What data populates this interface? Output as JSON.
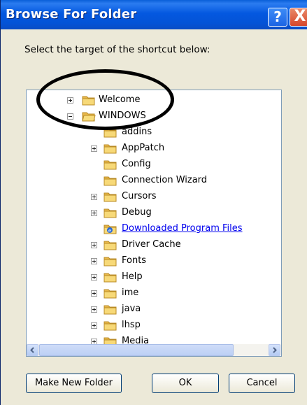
{
  "dialog": {
    "title": "Browse For Folder",
    "help_button": "?",
    "close_button": "X",
    "prompt": "Select the target of the shortcut below:"
  },
  "tree": {
    "items": [
      {
        "label": "Welcome",
        "expander": "+",
        "icon": "folder-icon",
        "level": 0
      },
      {
        "label": "WINDOWS",
        "expander": "-",
        "icon": "folder-open-icon",
        "level": 0
      },
      {
        "label": "addins",
        "expander": "",
        "icon": "folder-icon",
        "level": 1
      },
      {
        "label": "AppPatch",
        "expander": "+",
        "icon": "folder-icon",
        "level": 1
      },
      {
        "label": "Config",
        "expander": "",
        "icon": "folder-icon",
        "level": 1
      },
      {
        "label": "Connection Wizard",
        "expander": "",
        "icon": "folder-icon",
        "level": 1
      },
      {
        "label": "Cursors",
        "expander": "+",
        "icon": "folder-icon",
        "level": 1
      },
      {
        "label": "Debug",
        "expander": "+",
        "icon": "folder-icon",
        "level": 1
      },
      {
        "label": "Downloaded Program Files",
        "expander": "",
        "icon": "ie-folder-icon",
        "level": 1,
        "link": true
      },
      {
        "label": "Driver Cache",
        "expander": "+",
        "icon": "folder-icon",
        "level": 1
      },
      {
        "label": "Fonts",
        "expander": "+",
        "icon": "folder-icon",
        "level": 1
      },
      {
        "label": "Help",
        "expander": "+",
        "icon": "folder-icon",
        "level": 1
      },
      {
        "label": "ime",
        "expander": "+",
        "icon": "folder-icon",
        "level": 1
      },
      {
        "label": "java",
        "expander": "+",
        "icon": "folder-icon",
        "level": 1
      },
      {
        "label": "lhsp",
        "expander": "+",
        "icon": "folder-icon",
        "level": 1
      },
      {
        "label": "Media",
        "expander": "+",
        "icon": "folder-icon",
        "level": 1
      }
    ]
  },
  "scroll": {
    "vertical_position": 0.05,
    "horizontal_position": 0.0
  },
  "buttons": {
    "make_new_folder": "Make New Folder",
    "ok": "OK",
    "cancel": "Cancel"
  },
  "colors": {
    "title_bar": "#0458e0",
    "dialog_bg": "#ece9d8",
    "folder": "#f3d36b",
    "link": "#0000ee"
  }
}
